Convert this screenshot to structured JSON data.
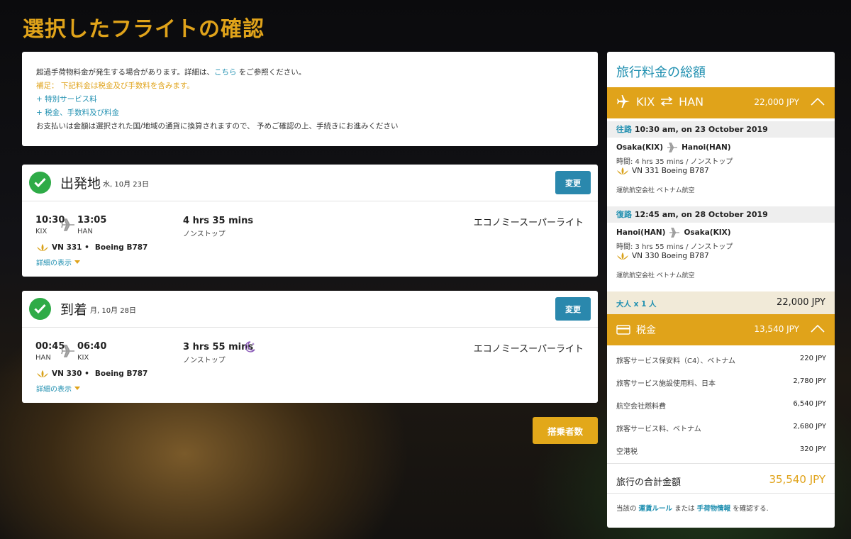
{
  "page_title": "選択したフライトの確認",
  "info": {
    "line1_pre": "超過手荷物料金が発生する場合があります。詳細は、",
    "line1_link": "こちら",
    "line1_post": " をご参照ください。",
    "line2": "補足： 下記料金は税金及び手数料を含みます。",
    "line3": "+ 特別サービス料",
    "line4": "+ 税金、手数料及び料金",
    "line5": "お支払いは金額は選択された国/地域の通貨に換算されますので、 予めご確認の上、手続きにお進みください"
  },
  "outbound": {
    "label": "出発地",
    "date": "水, 10月 23日",
    "change": "変更",
    "dep_time": "10:30",
    "dep_code": "KIX",
    "arr_time": "13:05",
    "arr_code": "HAN",
    "duration": "4 hrs 35 mins",
    "stops": "ノンストップ",
    "class": "エコノミースーパーライト",
    "flight": "VN 331 •",
    "aircraft": "Boeing B787",
    "details": "詳細の表示"
  },
  "inbound": {
    "label": "到着",
    "date": "月, 10月 28日",
    "change": "変更",
    "dep_time": "00:45",
    "dep_code": "HAN",
    "arr_time": "06:40",
    "arr_code": "KIX",
    "duration": "3 hrs 55 mins",
    "stops": "ノンストップ",
    "class": "エコノミースーパーライト",
    "flight": "VN 330 •",
    "aircraft": "Boeing B787",
    "details": "詳細の表示"
  },
  "passengers_button": "搭乗者数",
  "summary": {
    "title": "旅行料金の総額",
    "route_from": "KIX",
    "route_to": "HAN",
    "route_amount": "22,000 JPY",
    "out": {
      "tag": "往路",
      "when": "10:30 am, on 23 October 2019",
      "from": "Osaka(KIX)",
      "to": "Hanoi(HAN)",
      "time": "時間: 4 hrs 35 mins / ノンストップ",
      "flight": "VN 331 Boeing B787",
      "operator": "運航航空会社 ベトナム航空"
    },
    "ret": {
      "tag": "復路",
      "when": "12:45 am, on 28 October 2019",
      "from": "Hanoi(HAN)",
      "to": "Osaka(KIX)",
      "time": "時間: 3 hrs 55 mins / ノンストップ",
      "flight": "VN 330 Boeing B787",
      "operator": "運航航空会社 ベトナム航空"
    },
    "adult_label": "大人 x 1 人",
    "adult_amount": "22,000 JPY",
    "tax_label": "税金",
    "tax_amount": "13,540 JPY",
    "taxes": [
      {
        "name": "旅客サービス保安料（C4）、ベトナム",
        "value": "220 JPY"
      },
      {
        "name": "旅客サービス施設使用料、日本",
        "value": "2,780 JPY"
      },
      {
        "name": "航空会社燃料費",
        "value": "6,540 JPY"
      },
      {
        "name": "旅客サービス料、ベトナム",
        "value": "2,680 JPY"
      },
      {
        "name": "空港税",
        "value": "320 JPY"
      }
    ],
    "total_label": "旅行の合計金額",
    "total_amount": "35,540 JPY",
    "note_pre": "当該の ",
    "note_link1": "運賃ルール",
    "note_mid": " または ",
    "note_link2": "手荷物情報",
    "note_post": " を確認する."
  },
  "colors": {
    "gold": "#e0a31a",
    "teal": "#1f8fb0",
    "green": "#2eab47",
    "button": "#2a88ad"
  }
}
